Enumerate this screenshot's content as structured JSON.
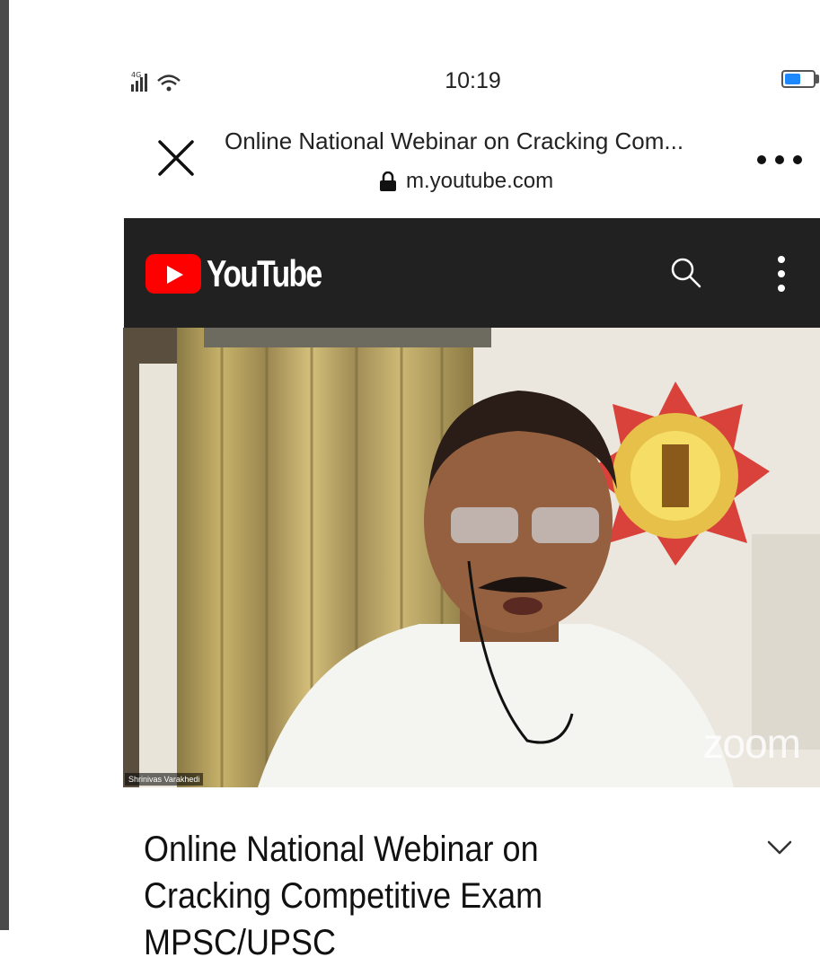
{
  "status_bar": {
    "time": "10:19",
    "battery_level": 0.55,
    "battery_color": "#1e88ff"
  },
  "browser": {
    "page_title": "Online National Webinar on Cracking Com...",
    "url": "m.youtube.com",
    "icons": {
      "close": "close-icon",
      "lock": "lock-icon",
      "more": "more-horizontal-icon"
    }
  },
  "youtube": {
    "wordmark": "YouTube",
    "brand_color": "#ff0000",
    "header_bg": "#212121",
    "icons": {
      "search": "search-icon",
      "menu": "more-vertical-icon"
    }
  },
  "video": {
    "participant_name": "Shrinivas Varakhedi",
    "watermark": "zoom"
  },
  "video_info": {
    "title": "Online National Webinar on Cracking Competitive Exam MPSC/UPSC",
    "expand_icon": "chevron-down-icon"
  }
}
